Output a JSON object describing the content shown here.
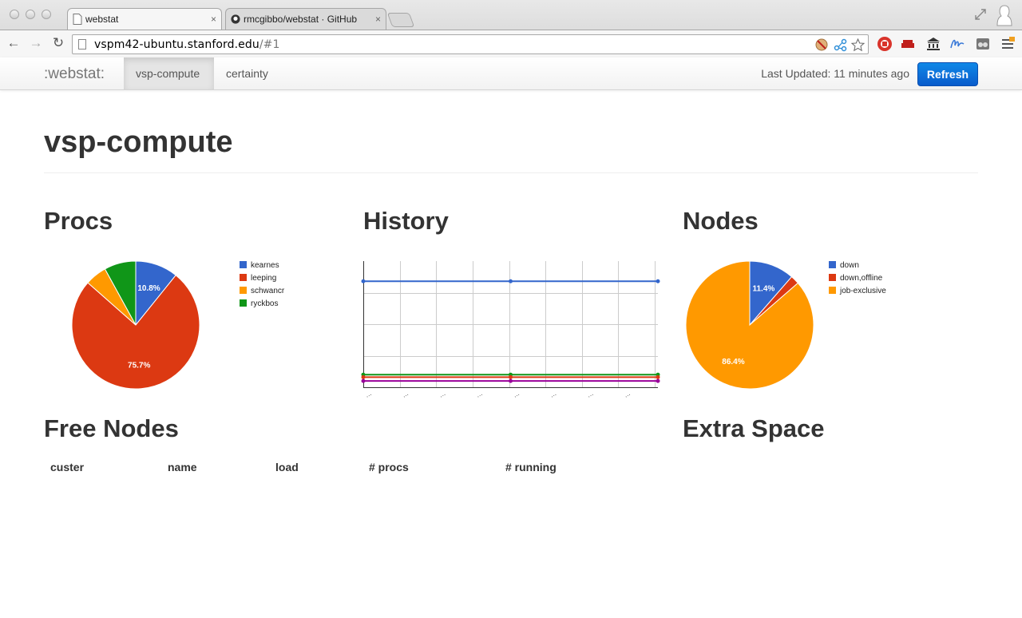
{
  "browser": {
    "tabs": [
      {
        "title": "webstat",
        "close": "×"
      },
      {
        "title": "rmcgibbo/webstat · GitHub",
        "close": "×"
      }
    ],
    "url_host": "vspm42-ubuntu.stanford.edu",
    "url_path": "/#1",
    "colors": {
      "ext_stop": "#d9342b",
      "ext_red": "#c0201c",
      "ext_blue": "#3b7ad8"
    }
  },
  "navbar": {
    "brand": ":webstat:",
    "tabs": [
      {
        "label": "vsp-compute",
        "active": true
      },
      {
        "label": "certainty",
        "active": false
      }
    ],
    "last_updated": "Last Updated: 11 minutes ago",
    "refresh_label": "Refresh",
    "refresh_color": "#0b6fd8"
  },
  "page": {
    "title": "vsp-compute",
    "sections": {
      "procs": "Procs",
      "history": "History",
      "nodes": "Nodes",
      "free_nodes": "Free Nodes",
      "extra_space": "Extra Space"
    }
  },
  "free_nodes_table": {
    "headers": [
      "custer",
      "name",
      "load",
      "# procs",
      "# running"
    ]
  },
  "chart_data": [
    {
      "type": "pie",
      "name": "procs",
      "labels": [
        "kearnes",
        "leeping",
        "schwancr",
        "ryckbos"
      ],
      "values": [
        10.8,
        75.7,
        5.5,
        8.0
      ],
      "slice_labels": [
        "10.8%",
        "75.7%",
        "",
        ""
      ],
      "colors": [
        "#3366cc",
        "#dc3912",
        "#ff9900",
        "#109618"
      ],
      "legend": "right"
    },
    {
      "type": "line",
      "name": "history",
      "x": [
        "…",
        "…",
        "…",
        "…",
        "…",
        "…",
        "…",
        "…"
      ],
      "ylim": [
        0,
        10
      ],
      "series": [
        {
          "color": "#3366cc",
          "values": [
            8.4,
            8.4,
            8.4
          ]
        },
        {
          "color": "#109618",
          "values": [
            1.0,
            1.0,
            1.0
          ]
        },
        {
          "color": "#dc3912",
          "values": [
            0.8,
            0.8,
            0.8
          ]
        },
        {
          "color": "#990099",
          "values": [
            0.5,
            0.5,
            0.5
          ]
        }
      ],
      "grid": true
    },
    {
      "type": "pie",
      "name": "nodes",
      "labels": [
        "down",
        "down,offline",
        "job-exclusive"
      ],
      "values": [
        11.4,
        2.2,
        86.4
      ],
      "slice_labels": [
        "11.4%",
        "",
        "86.4%"
      ],
      "colors": [
        "#3366cc",
        "#dc3912",
        "#ff9900"
      ],
      "legend": "right"
    }
  ]
}
